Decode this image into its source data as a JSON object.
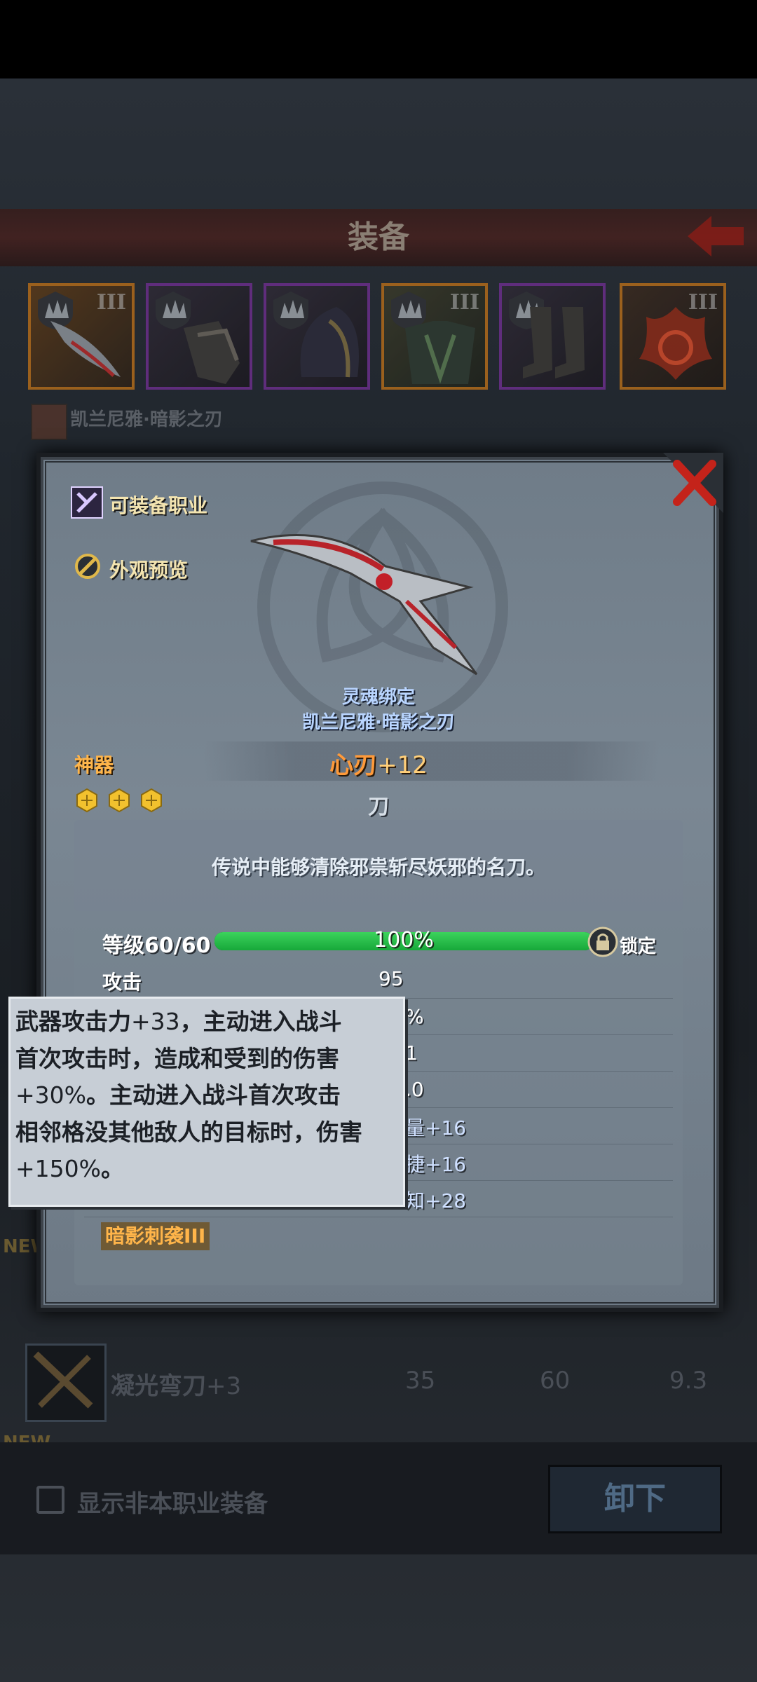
{
  "header": {
    "title": "装备"
  },
  "equipment_slots": [
    {
      "rank": "III",
      "item": "blade"
    },
    {
      "rank": "",
      "item": "gauntlet"
    },
    {
      "rank": "",
      "item": "hood"
    },
    {
      "rank": "III",
      "item": "armor"
    },
    {
      "rank": "",
      "item": "boots"
    },
    {
      "rank": "III",
      "item": "emblem"
    }
  ],
  "hero": {
    "name": "凯兰尼雅·暗影之刃"
  },
  "dialog": {
    "job_link": "可装备职业",
    "preview_link": "外观预览",
    "soulbound": "灵魂绑定",
    "owner": "凯兰尼雅·暗影之刃",
    "quality": "神器",
    "item_name": "心刃",
    "item_plus": "+12",
    "stars": 3,
    "item_type": "刀",
    "description": "传说中能够清除邪祟斩尽妖邪的名刀。",
    "level_label": "等级60/60",
    "level_percent_text": "100%",
    "level_fraction": 1.0,
    "lock_label": "锁定",
    "stats": [
      {
        "name": "攻击",
        "value": "95"
      },
      {
        "name": "",
        "value": "%"
      },
      {
        "name": "",
        "value": "1"
      },
      {
        "name": "",
        "value": ".0"
      },
      {
        "name": "",
        "value": "量+16"
      },
      {
        "name": "",
        "value": "捷+16"
      },
      {
        "name": "",
        "value": "知+28"
      }
    ],
    "skill": "暗影刺袭III"
  },
  "tooltip": {
    "lines": [
      [
        "武器攻击力",
        "+33",
        "，主动进入战斗"
      ],
      [
        "首次攻击时，造成和受到的伤害"
      ],
      [
        "",
        "+30%",
        "。主动进入战斗首次攻击"
      ],
      [
        "相邻格没其他敌人的目标时，伤害"
      ],
      [
        "",
        "+150%",
        "。"
      ]
    ]
  },
  "list": {
    "new_tag": "NEW",
    "row": {
      "name": "凝光弯刀",
      "plus": "+3",
      "c1": "35",
      "c2": "60",
      "c3": "9.3"
    }
  },
  "footer": {
    "checkbox_label": "显示非本职业装备",
    "unequip_label": "卸下"
  },
  "colors": {
    "quality": "#ffb54a",
    "name": "#ff9a3a",
    "level_bar": "#2bc04a",
    "soulbound": "#b9d5ff"
  }
}
